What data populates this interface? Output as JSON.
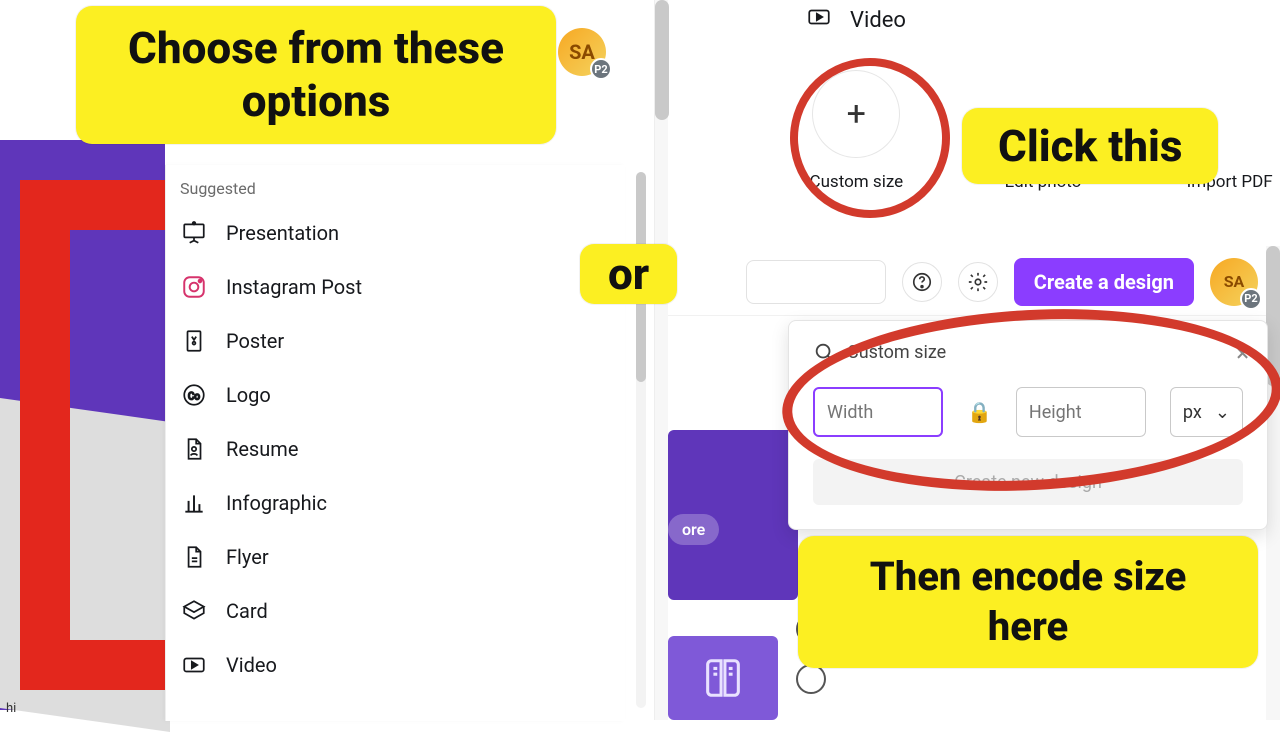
{
  "annotations": {
    "choose": "Choose from these options",
    "or": "or",
    "click": "Click this",
    "encode": "Then encode size here"
  },
  "avatar": {
    "initials": "SA",
    "badge": "P2"
  },
  "left": {
    "suggested_label": "Suggested",
    "items": [
      {
        "label": "Presentation"
      },
      {
        "label": "Instagram Post"
      },
      {
        "label": "Poster"
      },
      {
        "label": "Logo"
      },
      {
        "label": "Resume"
      },
      {
        "label": "Infographic"
      },
      {
        "label": "Flyer"
      },
      {
        "label": "Card"
      },
      {
        "label": "Video"
      }
    ],
    "caption_fragment": "hi"
  },
  "right": {
    "video_label": "Video",
    "tiles": {
      "custom": "Custom size",
      "edit": "Edit photo",
      "import": "Import PDF"
    },
    "create_btn": "Create a design",
    "more": "ore",
    "popup": {
      "title": "Custom size",
      "width_ph": "Width",
      "height_ph": "Height",
      "unit": "px",
      "create": "Create new design"
    }
  }
}
